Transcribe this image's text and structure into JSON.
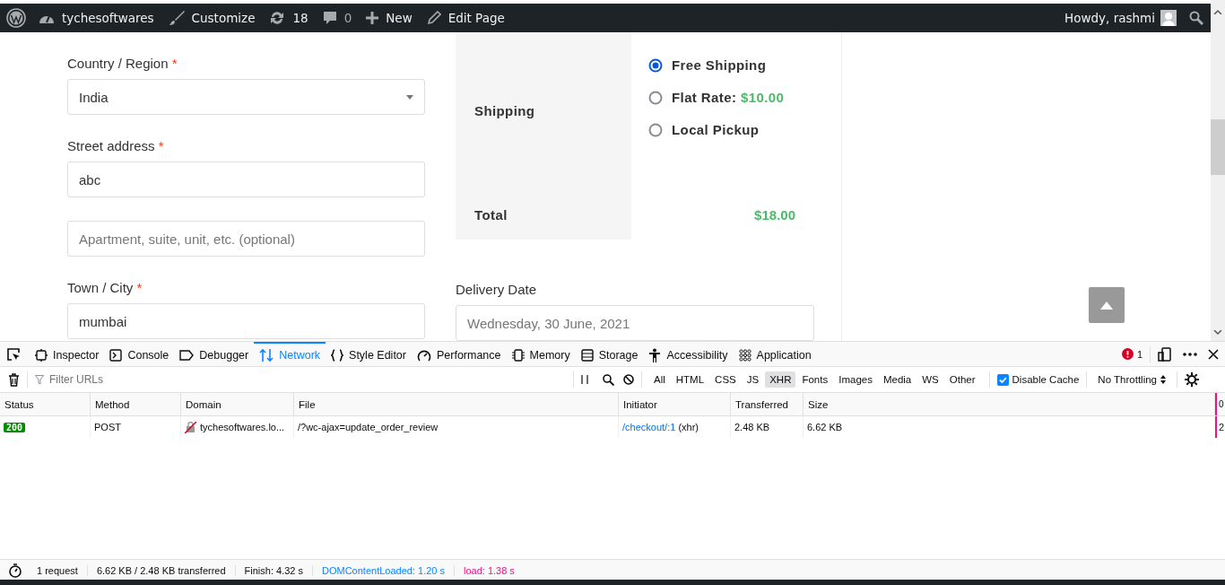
{
  "admin_bar": {
    "site": "tychesoftwares",
    "customize": "Customize",
    "updates": "18",
    "comments": "0",
    "new": "New",
    "edit": "Edit Page",
    "greeting": "Howdy, rashmi"
  },
  "checkout": {
    "fields": [
      {
        "kind": "select",
        "label": "Country / Region",
        "required": "*",
        "value": "India"
      },
      {
        "kind": "text",
        "label": "Street address",
        "required": "*",
        "value": "abc"
      },
      {
        "kind": "text",
        "placeholder": "Apartment, suite, unit, etc. (optional)"
      },
      {
        "kind": "text",
        "label": "Town / City",
        "required": "*",
        "value": "mumbai"
      }
    ],
    "order_review": {
      "shipping_label": "Shipping",
      "options": [
        {
          "label": "Free Shipping",
          "selected": true
        },
        {
          "label": "Flat Rate:",
          "price": "$10.00",
          "selected": false
        },
        {
          "label": "Local Pickup",
          "selected": false
        }
      ],
      "total_label": "Total",
      "total": "$18.00"
    },
    "delivery_date": {
      "label": "Delivery Date",
      "placeholder": "Wednesday, 30 June, 2021"
    }
  },
  "devtools": {
    "tabs": [
      {
        "label": "Inspector",
        "selected": false
      },
      {
        "label": "Console",
        "selected": false
      },
      {
        "label": "Debugger",
        "selected": false
      },
      {
        "label": "Network",
        "selected": true
      },
      {
        "label": "Style Editor",
        "selected": false
      },
      {
        "label": "Performance",
        "selected": false
      },
      {
        "label": "Memory",
        "selected": false
      },
      {
        "label": "Storage",
        "selected": false
      },
      {
        "label": "Accessibility",
        "selected": false
      },
      {
        "label": "Application",
        "selected": false
      }
    ],
    "error_count": "1",
    "filter": {
      "placeholder": "Filter URLs"
    },
    "type_filters": [
      {
        "label": "All",
        "selected": false
      },
      {
        "label": "HTML",
        "selected": false
      },
      {
        "label": "CSS",
        "selected": false
      },
      {
        "label": "JS",
        "selected": false
      },
      {
        "label": "XHR",
        "selected": true
      },
      {
        "label": "Fonts",
        "selected": false
      },
      {
        "label": "Images",
        "selected": false
      },
      {
        "label": "Media",
        "selected": false
      },
      {
        "label": "WS",
        "selected": false
      },
      {
        "label": "Other",
        "selected": false
      }
    ],
    "disable_cache": {
      "label": "Disable Cache",
      "checked": true
    },
    "throttling": "No Throttling",
    "columns": [
      "Status",
      "Method",
      "Domain",
      "File",
      "Initiator",
      "Transferred",
      "Size",
      "0"
    ],
    "rows": [
      {
        "status": "200",
        "method": "POST",
        "domain": "tychesoftwares.lo...",
        "file": "/?wc-ajax=update_order_review",
        "initiator": "/checkout/:1",
        "initiator_type": "(xhr)",
        "transferred": "2.48 KB",
        "size": "6.62 KB",
        "column_8": "2"
      }
    ],
    "summary": [
      {
        "kind": "plain",
        "text": "1 request"
      },
      {
        "kind": "plain",
        "text": "6.62 KB / 2.48 KB transferred"
      },
      {
        "kind": "plain",
        "text": "Finish: 4.32 s"
      },
      {
        "kind": "dom",
        "text": "DOMContentLoaded: 1.20 s"
      },
      {
        "kind": "load",
        "text": "load: 1.38 s"
      }
    ]
  }
}
